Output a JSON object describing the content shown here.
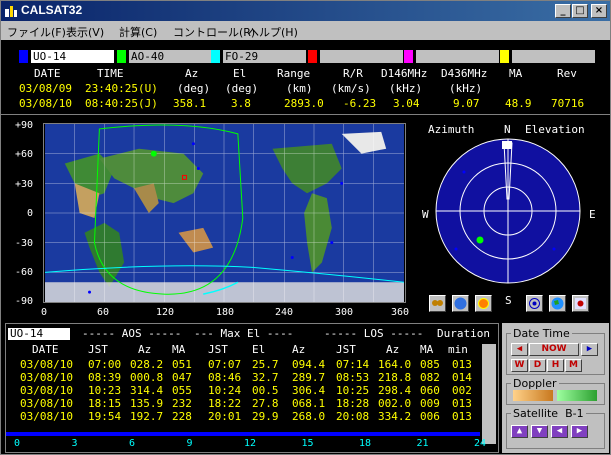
{
  "window": {
    "title": "CALSAT32",
    "min_icon": "minimize-icon",
    "max_icon": "maximize-icon",
    "close_icon": "close-icon"
  },
  "menu": [
    {
      "label": "ファイル(F)"
    },
    {
      "label": "表示(V)"
    },
    {
      "label": "計算(C)"
    },
    {
      "label": "コントロール(R)"
    },
    {
      "label": "ヘルプ(H)"
    }
  ],
  "satellites": [
    {
      "name": "UO-14",
      "color": "#0000ff"
    },
    {
      "name": "AO-40",
      "color": "#00ff00"
    },
    {
      "name": "FO-29",
      "color": "#00ffff"
    },
    {
      "name": "",
      "color": "#ff0000"
    },
    {
      "name": "",
      "color": "#ff00ff"
    },
    {
      "name": "",
      "color": "#ffff00"
    }
  ],
  "status_headers": {
    "date": "DATE",
    "time": "TIME",
    "az": "Az",
    "el": "El",
    "range": "Range",
    "rr": "R/R",
    "d146": "D146MHz",
    "d436": "D436MHz",
    "ma": "MA",
    "rev": "Rev"
  },
  "status_units": {
    "az": "(deg)",
    "el": "(deg)",
    "range": "(km)",
    "rr": "(km/s)",
    "d146": "(kHz)",
    "d436": "(kHz)"
  },
  "status_rows": [
    {
      "date": "03/08/09",
      "time": "23:40:25(U)"
    },
    {
      "date": "03/08/10",
      "time": "08:40:25(J)",
      "az": "358.1",
      "el": "3.8",
      "range": "2893.0",
      "rr": "-6.23",
      "d146": "3.04",
      "d436": "9.07",
      "ma": "48.9",
      "rev": "70716"
    }
  ],
  "map": {
    "lat_labels": [
      "+90",
      "+60",
      "+30",
      "0",
      "-30",
      "-60",
      "-90"
    ],
    "lon_labels": [
      "0",
      "60",
      "120",
      "180",
      "240",
      "300",
      "360"
    ]
  },
  "polar": {
    "title_az": "Azimuth",
    "title_el": "Elevation",
    "n": "N",
    "s": "S",
    "e": "E",
    "w": "W"
  },
  "passes": {
    "sat_name": "UO-14",
    "group_aos": "----- AOS -----",
    "group_max": "--- Max El ----",
    "group_los": "----- LOS -----",
    "duration": "Duration",
    "cols": {
      "date": "DATE",
      "jst1": "JST",
      "az1": "Az",
      "ma1": "MA",
      "jst2": "JST",
      "el": "El",
      "az2": "Az",
      "jst3": "JST",
      "az3": "Az",
      "ma3": "MA",
      "min": "min"
    },
    "rows": [
      {
        "date": "03/08/10",
        "aos_t": "07:00",
        "aos_az": "028.2",
        "aos_ma": "051",
        "max_t": "07:07",
        "max_el": "25.7",
        "max_az": "094.4",
        "los_t": "07:14",
        "los_az": "164.0",
        "los_ma": "085",
        "dur": "013"
      },
      {
        "date": "03/08/10",
        "aos_t": "08:39",
        "aos_az": "000.8",
        "aos_ma": "047",
        "max_t": "08:46",
        "max_el": "32.7",
        "max_az": "289.7",
        "los_t": "08:53",
        "los_az": "218.8",
        "los_ma": "082",
        "dur": "014"
      },
      {
        "date": "03/08/10",
        "aos_t": "10:23",
        "aos_az": "314.4",
        "aos_ma": "055",
        "max_t": "10:24",
        "max_el": "00.5",
        "max_az": "306.4",
        "los_t": "10:25",
        "los_az": "298.4",
        "los_ma": "060",
        "dur": "002"
      },
      {
        "date": "03/08/10",
        "aos_t": "18:15",
        "aos_az": "135.9",
        "aos_ma": "232",
        "max_t": "18:22",
        "max_el": "27.8",
        "max_az": "068.1",
        "los_t": "18:28",
        "los_az": "002.0",
        "los_ma": "009",
        "dur": "013"
      },
      {
        "date": "03/08/10",
        "aos_t": "19:54",
        "aos_az": "192.7",
        "aos_ma": "228",
        "max_t": "20:01",
        "max_el": "29.9",
        "max_az": "268.0",
        "los_t": "20:08",
        "los_az": "334.2",
        "los_ma": "006",
        "dur": "013"
      }
    ],
    "timeline": [
      "0",
      "3",
      "6",
      "9",
      "12",
      "15",
      "18",
      "21",
      "24"
    ]
  },
  "panel": {
    "datetime_label": "Date Time",
    "now_label": "NOW",
    "w_label": "W",
    "d_label": "D",
    "h_label": "H",
    "m_label": "M",
    "doppler_label": "Doppler",
    "satellite_label": "Satellite",
    "satellite_value": "B-1"
  }
}
